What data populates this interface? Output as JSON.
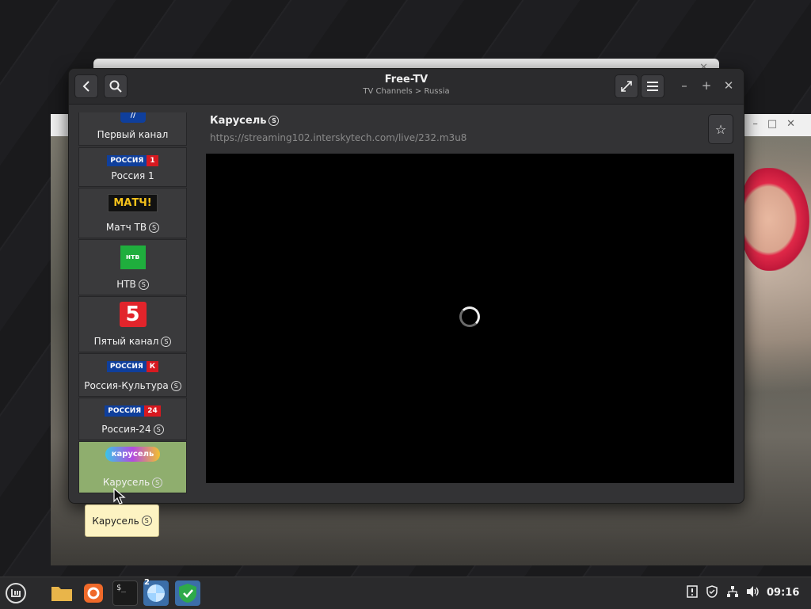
{
  "app": {
    "title": "Free-TV",
    "subtitle": "TV Channels > Russia"
  },
  "channels": [
    {
      "name": "Первый канал",
      "logo": "channel-one-logo",
      "badge": ""
    },
    {
      "name": "Россия 1",
      "logo": "russia-1-logo",
      "logo_text_a": "РОССИЯ",
      "logo_text_b": "1",
      "badge": ""
    },
    {
      "name": "Матч ТВ",
      "logo": "match-tv-logo",
      "logo_text": "МАТЧ!",
      "badge": "S"
    },
    {
      "name": "НТВ",
      "logo": "ntv-logo",
      "badge": "S"
    },
    {
      "name": "Пятый канал",
      "logo": "channel-5-logo",
      "logo_text": "5",
      "badge": "S"
    },
    {
      "name": "Россия-Культура",
      "logo": "russia-k-logo",
      "logo_text_a": "РОССИЯ",
      "logo_text_b": "К",
      "badge": "S"
    },
    {
      "name": "Россия-24",
      "logo": "russia-24-logo",
      "logo_text_a": "РОССИЯ",
      "logo_text_b": "24",
      "badge": "S"
    },
    {
      "name": "Карусель",
      "logo": "karusel-logo",
      "logo_text": "карусель",
      "badge": "S",
      "selected": true
    }
  ],
  "player": {
    "channel_title": "Карусель",
    "badge": "S",
    "stream_url": "https://streaming102.interskytech.com/live/232.m3u8"
  },
  "tooltip": {
    "text": "Карусель",
    "badge": "S"
  },
  "taskbar": {
    "clock": "09:16",
    "workspace_badge": "2"
  },
  "colors": {
    "selected_channel": "#8fae6e",
    "window_bg": "#333335",
    "tooltip_bg": "#fdf3c2"
  }
}
